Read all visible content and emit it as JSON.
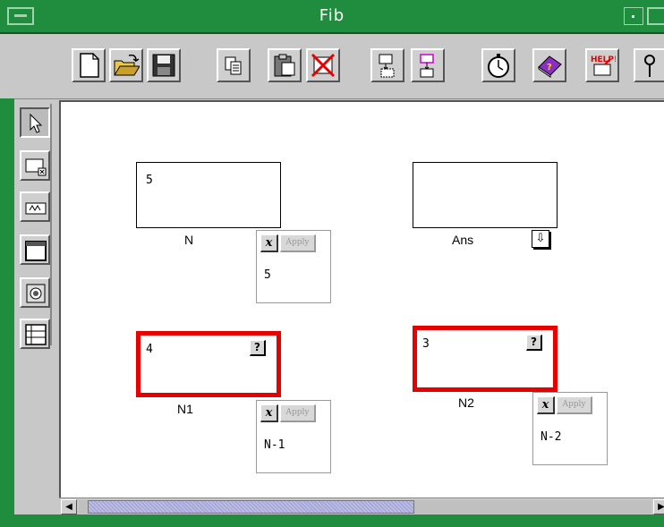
{
  "window": {
    "title": "Fib"
  },
  "toolbar": {
    "buttons": [
      "new-icon",
      "open-icon",
      "save-icon",
      "copy-icon",
      "paste-icon",
      "delete-icon",
      "import-icon",
      "export-icon",
      "stopwatch-icon",
      "book-icon",
      "help-icon"
    ],
    "help_label": "HELP!"
  },
  "toolbox": {
    "tools": [
      "pointer-icon",
      "cell-tool-icon",
      "formula-tool-icon",
      "box-tool-icon",
      "radio-tool-icon",
      "list-tool-icon"
    ]
  },
  "cells": {
    "n": {
      "value": "5",
      "label": "N"
    },
    "ans": {
      "value": "",
      "label": "Ans"
    },
    "n1": {
      "value": "4",
      "label": "N1",
      "q": "?"
    },
    "n2": {
      "value": "3",
      "label": "N2",
      "q": "?"
    }
  },
  "formulas": {
    "n": {
      "x": "x",
      "apply": "Apply",
      "text": "5"
    },
    "n1": {
      "x": "x",
      "apply": "Apply",
      "text": "N-1"
    },
    "n2": {
      "x": "x",
      "apply": "Apply",
      "text": "N-2"
    }
  },
  "scrollbar": {
    "left": "◀",
    "right": "▶",
    "thumb_fraction": 0.58
  },
  "colors": {
    "titlebar": "#1f8c3e",
    "highlight": "#e60000",
    "thumb": "#a7a7d8"
  }
}
